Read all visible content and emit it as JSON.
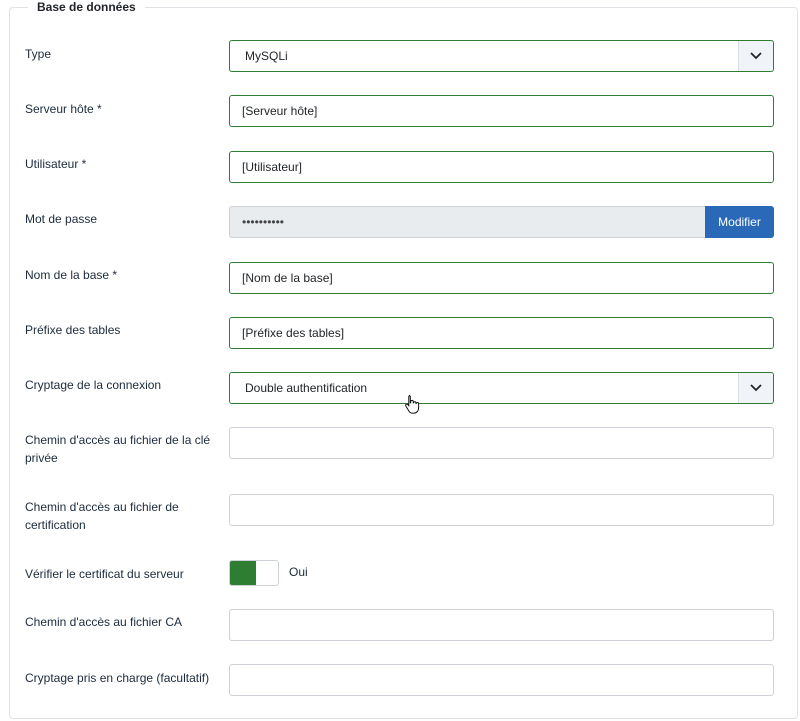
{
  "fieldset": {
    "legend": "Base de données"
  },
  "fields": {
    "type": {
      "label": "Type",
      "value": "MySQLi"
    },
    "host": {
      "label": "Serveur hôte *",
      "value": "[Serveur hôte]"
    },
    "user": {
      "label": "Utilisateur *",
      "value": "[Utilisateur]"
    },
    "password": {
      "label": "Mot de passe",
      "value": "••••••••••",
      "button": "Modifier"
    },
    "dbname": {
      "label": "Nom de la base *",
      "value": "[Nom de la base]"
    },
    "prefix": {
      "label": "Préfixe des tables",
      "value": "[Préfixe des tables]"
    },
    "encryption": {
      "label": "Cryptage de la connexion",
      "value": "Double authentification"
    },
    "key_path": {
      "label": "Chemin d'accès au fichier de la clé privée",
      "value": ""
    },
    "cert_path": {
      "label": "Chemin d'accès au fichier de certification",
      "value": ""
    },
    "verify_cert": {
      "label": "Vérifier le certificat du serveur",
      "state": "Oui"
    },
    "ca_path": {
      "label": "Chemin d'accès au fichier CA",
      "value": ""
    },
    "cipher": {
      "label": "Cryptage pris en charge (facultatif)",
      "value": ""
    }
  },
  "colors": {
    "accent_green": "#2e7d32",
    "button_blue": "#2a68b8"
  },
  "icons": {
    "select_arrow": "chevron-down-icon",
    "cursor": "hand-pointer-icon"
  }
}
